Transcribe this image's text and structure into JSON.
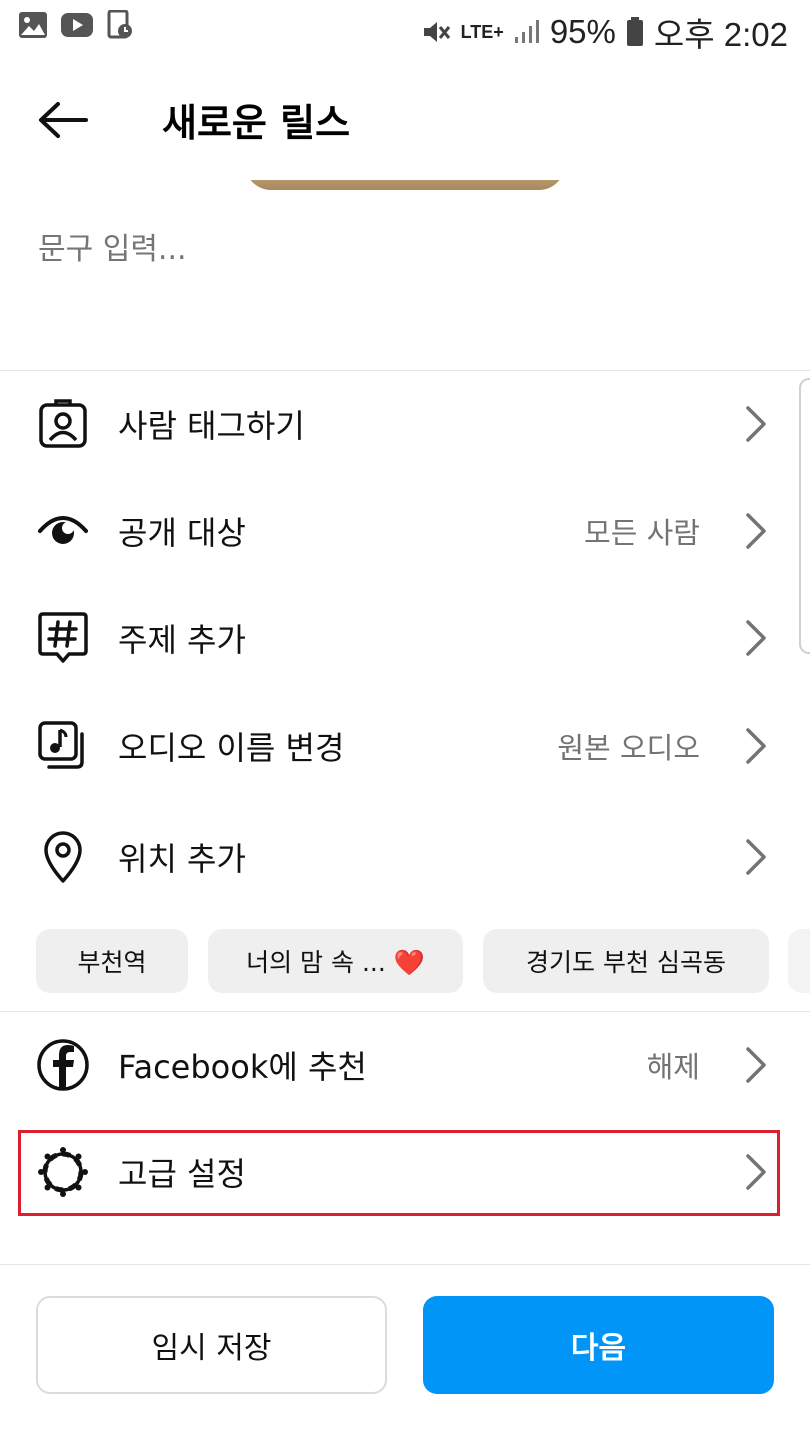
{
  "status_bar": {
    "network": "LTE+",
    "battery": "95%",
    "time": "오후 2:02"
  },
  "header": {
    "title": "새로운 릴스"
  },
  "caption": {
    "placeholder": "문구 입력..."
  },
  "menu": {
    "tag_people": {
      "label": "사람 태그하기"
    },
    "audience": {
      "label": "공개 대상",
      "value": "모든 사람"
    },
    "topics": {
      "label": "주제 추가"
    },
    "rename_audio": {
      "label": "오디오 이름 변경",
      "value": "원본 오디오"
    },
    "location": {
      "label": "위치 추가"
    },
    "facebook": {
      "label": "Facebook에 추천",
      "value": "해제"
    },
    "advanced": {
      "label": "고급 설정"
    }
  },
  "location_chips": [
    "부천역",
    "너의 맘 속 ... ❤️",
    "경기도 부천 심곡동"
  ],
  "footer": {
    "draft_label": "임시 저장",
    "next_label": "다음"
  },
  "colors": {
    "accent": "#0095f6",
    "highlight": "#d9202c"
  }
}
